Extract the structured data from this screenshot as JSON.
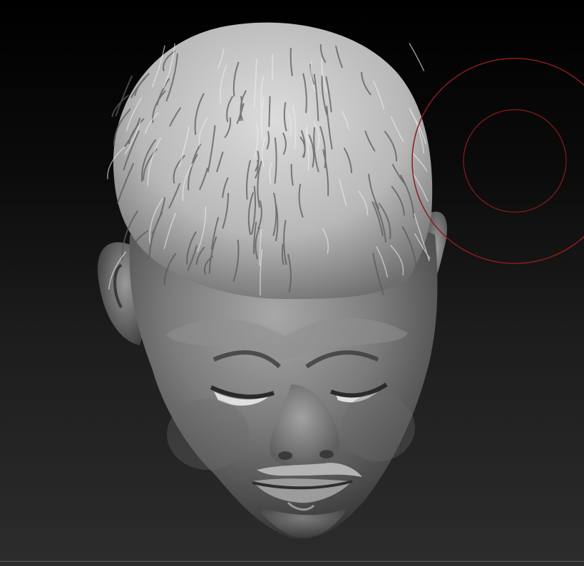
{
  "viewport": {
    "background_top": "#000000",
    "background_bottom": "#2c2c2c",
    "model": "sculpted-head",
    "material_color": "#9a9a9a",
    "hair_color": "#c9c9c9"
  },
  "brush_cursor": {
    "color": "#8e1b1b",
    "icon": "brush-circle-icon"
  }
}
